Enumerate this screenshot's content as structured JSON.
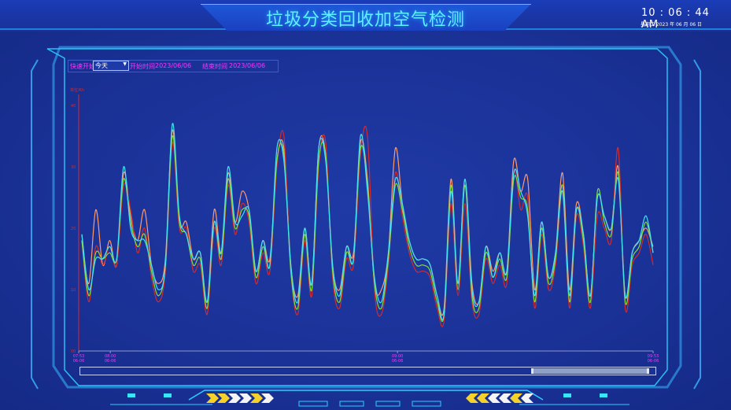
{
  "header": {
    "title": "垃圾分类回收加空气检测",
    "clock": "10 : 06 : 44 AM",
    "date": "星期二   2023 年 06 月 06 日"
  },
  "toolbar": {
    "quick_label": "快速开始",
    "quick_value": "今天",
    "start_label": "开始时间",
    "start_value": "2023/06/06",
    "end_label": "结束时间",
    "end_value": "2023/06/06"
  },
  "chart_data": {
    "type": "line",
    "ylabel": "单位/Kh",
    "yticks": [
      "40",
      "30",
      "20",
      "10",
      "00"
    ],
    "ylim": [
      0,
      40
    ],
    "x_ticks": [
      {
        "time": "07:53",
        "date": "06-06",
        "pos": 0.0
      },
      {
        "time": "08:00",
        "date": "06-06",
        "pos": 0.055
      },
      {
        "time": "09:00",
        "date": "06-06",
        "pos": 0.555
      },
      {
        "time": "09:53",
        "date": "06-06",
        "pos": 1.0
      }
    ],
    "grid": false,
    "series": [
      {
        "color": "#ff9a6a",
        "values": [
          19,
          11,
          23,
          14,
          18,
          14,
          29,
          22,
          18,
          23,
          14,
          11,
          15,
          36,
          21,
          21,
          15,
          16,
          8,
          23,
          16,
          29,
          21,
          26,
          23,
          13,
          18,
          15,
          31,
          33,
          14,
          9,
          20,
          11,
          33,
          32,
          14,
          10,
          17,
          16,
          34,
          28,
          11,
          10,
          16,
          33,
          24,
          18,
          15,
          15,
          14,
          9,
          7,
          28,
          11,
          28,
          11,
          8,
          17,
          13,
          16,
          13,
          31,
          26,
          28,
          10,
          21,
          12,
          16,
          29,
          10,
          24,
          19,
          9,
          25,
          22,
          20,
          30,
          9,
          16,
          18,
          20,
          17
        ]
      },
      {
        "color": "#d42a2a",
        "values": [
          18,
          8,
          17,
          14,
          17,
          14,
          27,
          23,
          16,
          20,
          12,
          8,
          13,
          34,
          20,
          20,
          13,
          14,
          6,
          20,
          14,
          27,
          19,
          24,
          21,
          11,
          16,
          13,
          30,
          35,
          13,
          6,
          18,
          9,
          30,
          34,
          12,
          7,
          15,
          14,
          32,
          35,
          10,
          6,
          14,
          29,
          22,
          16,
          13,
          13,
          12,
          7,
          5,
          24,
          9,
          24,
          8,
          6,
          15,
          11,
          14,
          11,
          29,
          23,
          25,
          7,
          19,
          10,
          14,
          26,
          7,
          22,
          17,
          7,
          22,
          20,
          18,
          33,
          7,
          14,
          16,
          19,
          14
        ]
      },
      {
        "color": "#7edc3c",
        "values": [
          18,
          9,
          16,
          15,
          16,
          15,
          28,
          21,
          17,
          19,
          13,
          9,
          14,
          35,
          21,
          19,
          14,
          15,
          7,
          21,
          15,
          28,
          20,
          23,
          22,
          12,
          17,
          14,
          31,
          32,
          13,
          7,
          19,
          10,
          31,
          32,
          13,
          8,
          16,
          15,
          33,
          27,
          11,
          7,
          15,
          27,
          23,
          17,
          14,
          14,
          13,
          8,
          6,
          27,
          10,
          27,
          9,
          7,
          16,
          12,
          15,
          12,
          28,
          25,
          23,
          8,
          20,
          11,
          15,
          27,
          8,
          23,
          18,
          8,
          26,
          21,
          19,
          29,
          8,
          15,
          17,
          21,
          16
        ]
      },
      {
        "color": "#40e4f4",
        "values": [
          19,
          10,
          15,
          15,
          17,
          15,
          30,
          20,
          18,
          18,
          14,
          10,
          14,
          37,
          22,
          19,
          15,
          16,
          8,
          21,
          16,
          30,
          21,
          22,
          23,
          13,
          18,
          14,
          33,
          31,
          14,
          8,
          20,
          11,
          33,
          31,
          14,
          9,
          17,
          15,
          35,
          26,
          12,
          8,
          16,
          28,
          24,
          18,
          15,
          15,
          14,
          9,
          6,
          26,
          11,
          28,
          10,
          8,
          17,
          12,
          16,
          13,
          29,
          26,
          22,
          9,
          21,
          12,
          16,
          26,
          9,
          23,
          19,
          9,
          25,
          22,
          20,
          28,
          9,
          16,
          18,
          22,
          16
        ]
      }
    ]
  }
}
